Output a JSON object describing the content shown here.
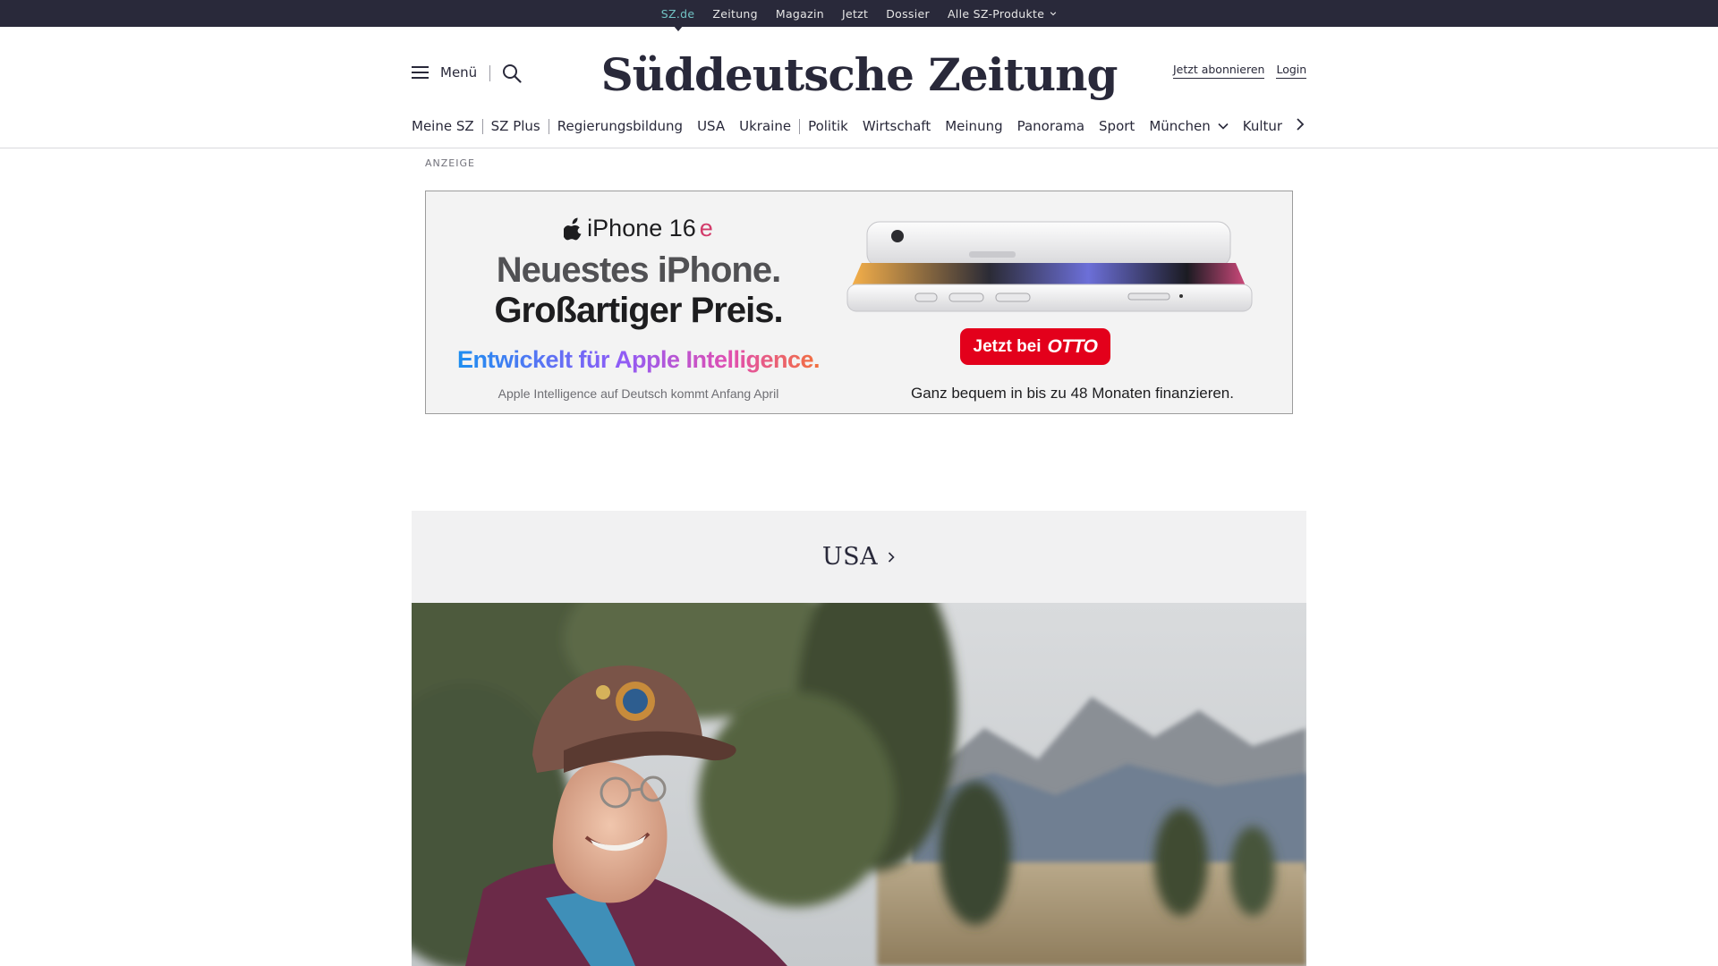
{
  "topbar": {
    "items": [
      {
        "label": "SZ.de",
        "active": true
      },
      {
        "label": "Zeitung"
      },
      {
        "label": "Magazin"
      },
      {
        "label": "Jetzt"
      },
      {
        "label": "Dossier"
      },
      {
        "label": "Alle SZ-Produkte",
        "dropdown": true
      }
    ],
    "background": "#29293a",
    "active_color": "#71c3c4"
  },
  "header": {
    "menu_label": "Menü",
    "logo_text": "Süddeutsche Zeitung",
    "subscribe_label": "Jetzt abonnieren",
    "login_label": "Login"
  },
  "nav": {
    "items": [
      {
        "label": "Meine SZ"
      },
      {
        "label": "SZ Plus"
      },
      {
        "label": "Regierungsbildung"
      },
      {
        "label": "USA"
      },
      {
        "label": "Ukraine"
      },
      {
        "label": "Politik"
      },
      {
        "label": "Wirtschaft"
      },
      {
        "label": "Meinung"
      },
      {
        "label": "Panorama"
      },
      {
        "label": "Sport"
      },
      {
        "label": "München",
        "dropdown": true
      },
      {
        "label": "Kultur"
      }
    ]
  },
  "ad": {
    "label": "ANZEIGE",
    "brand": "iPhone 16",
    "brand_suffix": "e",
    "headline_1": "Neuestes iPhone.",
    "headline_2": "Großartiger Preis.",
    "intelligence": "Entwickelt für Apple Intelligence.",
    "note": "Apple Intelligence auf Deutsch kommt Anfang April",
    "cta_prefix": "Jetzt bei",
    "cta_brand": "OTTO",
    "finance": "Ganz bequem in bis zu 48 Monaten finanzieren.",
    "cta_color": "#e3001b"
  },
  "section": {
    "title": "USA"
  }
}
